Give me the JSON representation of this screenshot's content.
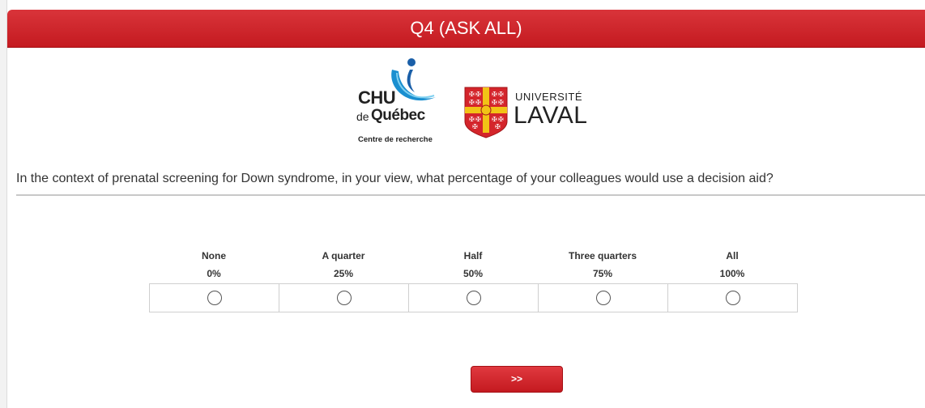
{
  "header": {
    "title": "Q4 (ASK ALL)"
  },
  "logos": {
    "chu": {
      "line1": "CHU",
      "line2_prefix": "de",
      "line2": "Québec",
      "line3": "Centre de recherche"
    },
    "laval": {
      "line1": "UNIVERSITÉ",
      "line2": "LAVAL"
    }
  },
  "question": {
    "text": "In the context of prenatal screening for Down syndrome, in your view, what percentage of your colleagues would use a decision aid?"
  },
  "scale": {
    "options": [
      {
        "label": "None",
        "percent": "0%",
        "selected": false
      },
      {
        "label": "A quarter",
        "percent": "25%",
        "selected": false
      },
      {
        "label": "Half",
        "percent": "50%",
        "selected": false
      },
      {
        "label": "Three quarters",
        "percent": "75%",
        "selected": false
      },
      {
        "label": "All",
        "percent": "100%",
        "selected": false
      }
    ]
  },
  "navigation": {
    "next_label": ">>"
  },
  "colors": {
    "header_red": "#c41a20",
    "button_red": "#d42a30",
    "chu_blue": "#1a7fc4",
    "laval_red": "#d4252b",
    "laval_gold": "#f2c316"
  }
}
